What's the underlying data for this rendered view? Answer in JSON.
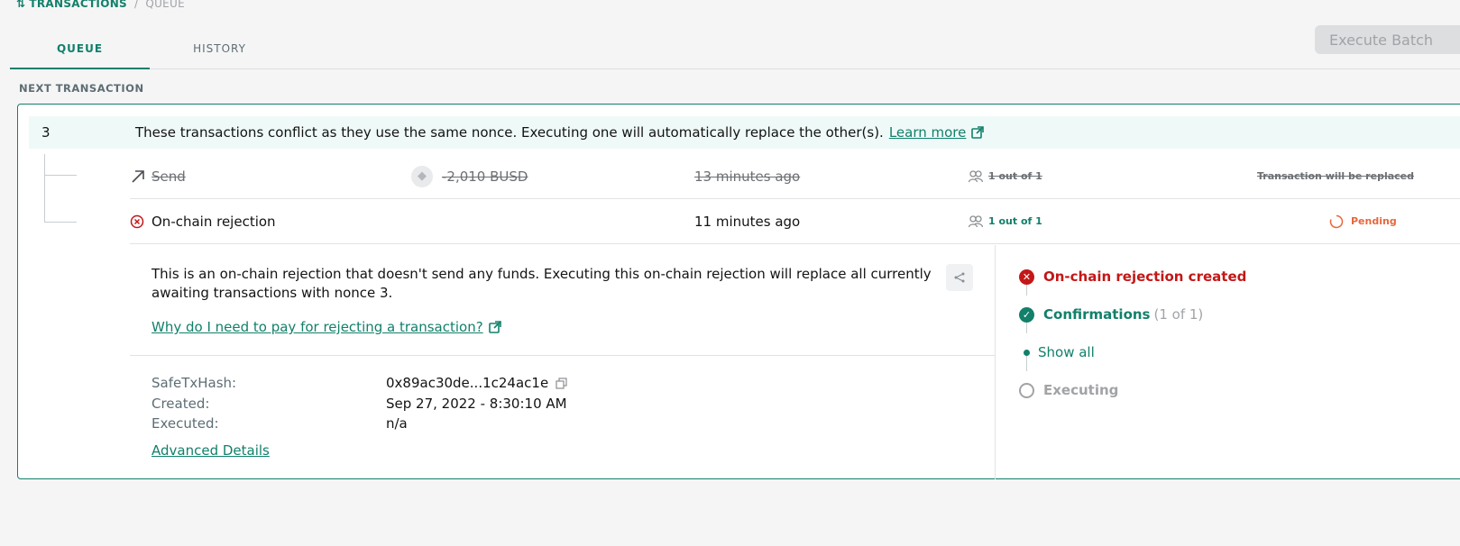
{
  "breadcrumb": {
    "section": "TRANSACTIONS",
    "separator": "/",
    "current": "QUEUE"
  },
  "tabs": [
    {
      "label": "QUEUE",
      "active": true
    },
    {
      "label": "HISTORY",
      "active": false
    }
  ],
  "execute_batch_label": "Execute Batch",
  "section_label": "NEXT TRANSACTION",
  "conflict": {
    "nonce": "3",
    "message": "These transactions conflict as they use the same nonce. Executing one will automatically replace the other(s).",
    "learn_more": "Learn more"
  },
  "transactions": [
    {
      "type": "Send",
      "amount": "-2,010 BUSD",
      "time": "13 minutes ago",
      "signers": "1 out of 1",
      "status": "Transaction will be replaced",
      "replaced": true
    },
    {
      "type": "On-chain rejection",
      "time": "11 minutes ago",
      "signers": "1 out of 1",
      "status": "Pending",
      "replaced": false
    }
  ],
  "details": {
    "description": "This is an on-chain rejection that doesn't send any funds. Executing this on-chain rejection will replace all currently awaiting transactions with nonce 3.",
    "why_link": "Why do I need to pay for rejecting a transaction?",
    "safe_tx_hash_label": "SafeTxHash:",
    "safe_tx_hash": "0x89ac30de...1c24ac1e",
    "created_label": "Created:",
    "created": "Sep 27, 2022 - 8:30:10 AM",
    "executed_label": "Executed:",
    "executed": "n/a",
    "advanced_details": "Advanced Details"
  },
  "timeline": {
    "created": "On-chain rejection created",
    "confirmations": "Confirmations",
    "confirmations_count": "(1 of 1)",
    "show_all": "Show all",
    "executing": "Executing"
  },
  "colors": {
    "accent": "#12806b",
    "error": "#c31717",
    "pending": "#e8673c",
    "muted": "#a1a3a7"
  }
}
